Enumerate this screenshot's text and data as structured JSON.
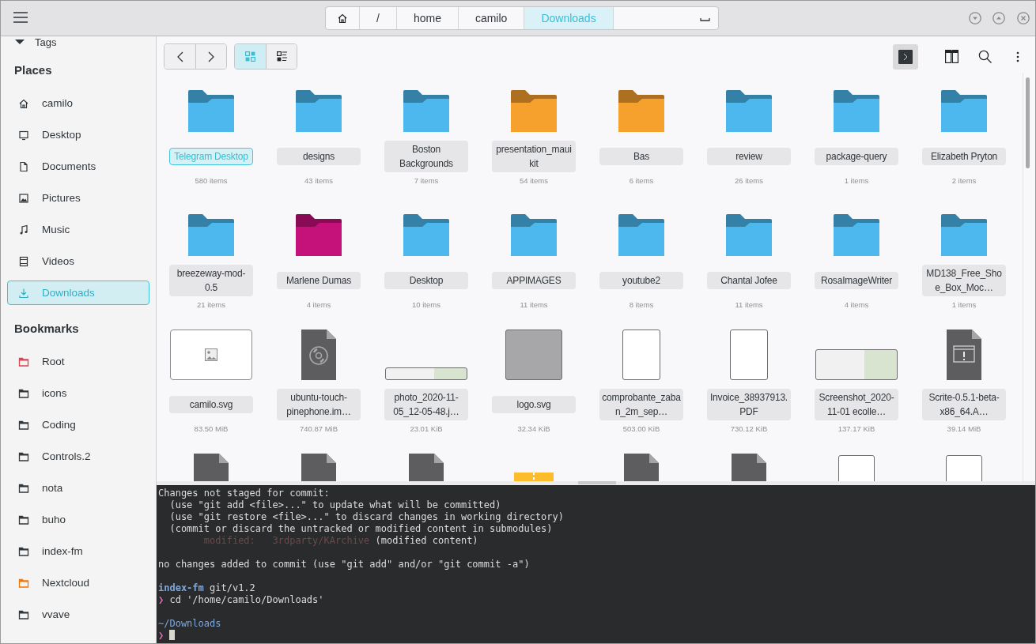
{
  "header": {
    "crumbs": [
      {
        "kind": "home",
        "selected": false
      },
      {
        "kind": "text",
        "label": "/",
        "selected": false
      },
      {
        "kind": "text",
        "label": "home",
        "selected": false
      },
      {
        "kind": "text",
        "label": "camilo",
        "selected": false
      },
      {
        "kind": "text",
        "label": "Downloads",
        "selected": true
      }
    ]
  },
  "sidebar": {
    "tags_label": "Tags",
    "sections": [
      {
        "title": "Places",
        "items": [
          {
            "kind": "home",
            "label": "camilo",
            "selected": false
          },
          {
            "kind": "desktop",
            "label": "Desktop",
            "selected": false
          },
          {
            "kind": "documents",
            "label": "Documents",
            "selected": false
          },
          {
            "kind": "pictures",
            "label": "Pictures",
            "selected": false
          },
          {
            "kind": "music",
            "label": "Music",
            "selected": false
          },
          {
            "kind": "videos",
            "label": "Videos",
            "selected": false
          },
          {
            "kind": "downloads",
            "label": "Downloads",
            "selected": true
          }
        ]
      },
      {
        "title": "Bookmarks",
        "items": [
          {
            "kind": "folder",
            "label": "Root",
            "color": "#da4453",
            "selected": false
          },
          {
            "kind": "folder",
            "label": "icons",
            "color": "#31363b",
            "selected": false
          },
          {
            "kind": "folder",
            "label": "Coding",
            "color": "#31363b",
            "selected": false
          },
          {
            "kind": "folder",
            "label": "Controls.2",
            "color": "#31363b",
            "selected": false
          },
          {
            "kind": "folder",
            "label": "nota",
            "color": "#31363b",
            "selected": false
          },
          {
            "kind": "folder",
            "label": "buho",
            "color": "#31363b",
            "selected": false
          },
          {
            "kind": "folder",
            "label": "index-fm",
            "color": "#31363b",
            "selected": false
          },
          {
            "kind": "folder",
            "label": "Nextcloud",
            "color": "#f67400",
            "selected": false
          },
          {
            "kind": "folder",
            "label": "vvave",
            "color": "#31363b",
            "selected": false
          }
        ]
      }
    ]
  },
  "toolbar": {
    "view_modes": [
      {
        "kind": "grid",
        "selected": true
      },
      {
        "kind": "list",
        "selected": false
      }
    ],
    "terminal_on": true
  },
  "items": [
    {
      "kind": "folder",
      "color": "#4db8ee",
      "name": "Telegram Desktop",
      "info": "580 items",
      "selected": true
    },
    {
      "kind": "folder",
      "color": "#4db8ee",
      "name": "designs",
      "info": "43 items",
      "selected": false
    },
    {
      "kind": "folder",
      "color": "#4db8ee",
      "name": "Boston Backgrounds",
      "info": "7 items",
      "selected": false
    },
    {
      "kind": "folder",
      "color": "#f6a12e",
      "name": "presentation_mauikit",
      "info": "54 items",
      "selected": false
    },
    {
      "kind": "folder",
      "color": "#f6a12e",
      "name": "Bas",
      "info": "6 items",
      "selected": false
    },
    {
      "kind": "folder",
      "color": "#4db8ee",
      "name": "review",
      "info": "26 items",
      "selected": false
    },
    {
      "kind": "folder",
      "color": "#4db8ee",
      "name": "package-query",
      "info": "1 items",
      "selected": false
    },
    {
      "kind": "folder",
      "color": "#4db8ee",
      "name": "Elizabeth Pryton",
      "info": "2 items",
      "selected": false
    },
    {
      "kind": "folder",
      "color": "#4db8ee",
      "name": "breezeway-mod-0.5",
      "info": "21 items",
      "selected": false
    },
    {
      "kind": "folder",
      "color": "#c5117a",
      "name": "Marlene Dumas",
      "info": "4 items",
      "selected": false
    },
    {
      "kind": "folder",
      "color": "#4db8ee",
      "name": "Desktop",
      "info": "10 items",
      "selected": false
    },
    {
      "kind": "folder",
      "color": "#4db8ee",
      "name": "APPIMAGES",
      "info": "11 items",
      "selected": false
    },
    {
      "kind": "folder",
      "color": "#4db8ee",
      "name": "youtube2",
      "info": "8 items",
      "selected": false
    },
    {
      "kind": "folder",
      "color": "#4db8ee",
      "name": "Chantal Jofee",
      "info": "11 items",
      "selected": false
    },
    {
      "kind": "folder",
      "color": "#4db8ee",
      "name": "RosaImageWriter",
      "info": "4 items",
      "selected": false
    },
    {
      "kind": "folder",
      "color": "#4db8ee",
      "name": "MD138_Free_Shoe_Box_Moc…",
      "info": "1 items",
      "selected": false
    },
    {
      "kind": "image",
      "name": "camilo.svg",
      "info": "83.50 MiB",
      "selected": false
    },
    {
      "kind": "disc",
      "name": "ubuntu-touch-pinephone.im…",
      "info": "740.87 MiB",
      "selected": false
    },
    {
      "kind": "wide-photo",
      "name": "photo_2020-11-05_12-05-48.j…",
      "info": "23.01 KiB",
      "selected": false
    },
    {
      "kind": "square-photo",
      "name": "logo.svg",
      "info": "32.34 KiB",
      "selected": false
    },
    {
      "kind": "page",
      "name": "comprobante_zaban_2m_sep…",
      "info": "503.00 KiB",
      "selected": false
    },
    {
      "kind": "page",
      "name": "Invoice_38937913.PDF",
      "info": "730.12 KiB",
      "selected": false
    },
    {
      "kind": "wide-photo",
      "name": "Screenshot_2020-11-01 ecolle…",
      "info": "137.17 KiB",
      "selected": false
    },
    {
      "kind": "executable",
      "name": "Scrite-0.5.1-beta-x86_64.A…",
      "info": "39.14 MiB",
      "selected": false
    },
    {
      "kind": "file"
    },
    {
      "kind": "file"
    },
    {
      "kind": "file"
    },
    {
      "kind": "archive"
    },
    {
      "kind": "file"
    },
    {
      "kind": "file"
    },
    {
      "kind": "sketch"
    },
    {
      "kind": "sketch"
    }
  ],
  "terminal": {
    "lines": [
      {
        "kind": "text",
        "text": "Changes not staged for commit:"
      },
      {
        "kind": "text",
        "text": "  (use \"git add <file>...\" to update what will be committed)"
      },
      {
        "kind": "text",
        "text": "  (use \"git restore <file>...\" to discard changes in working directory)"
      },
      {
        "kind": "text",
        "text": "  (commit or discard the untracked or modified content in submodules)"
      },
      {
        "kind": "modified",
        "label": "        modified:   3rdparty/KArchive",
        "text": " (modified content)"
      },
      {
        "kind": "blank"
      },
      {
        "kind": "text",
        "text": "no changes added to commit (use \"git add\" and/or \"git commit -a\")"
      },
      {
        "kind": "blank"
      },
      {
        "kind": "prompt",
        "label": "index-fm",
        "text": " git/v1.2"
      },
      {
        "kind": "command",
        "label": "❯",
        "text": " cd '/home/camilo/Downloads'"
      },
      {
        "kind": "blank"
      },
      {
        "kind": "cwd",
        "text": "~/Downloads"
      },
      {
        "kind": "input",
        "label": "❯"
      }
    ]
  }
}
